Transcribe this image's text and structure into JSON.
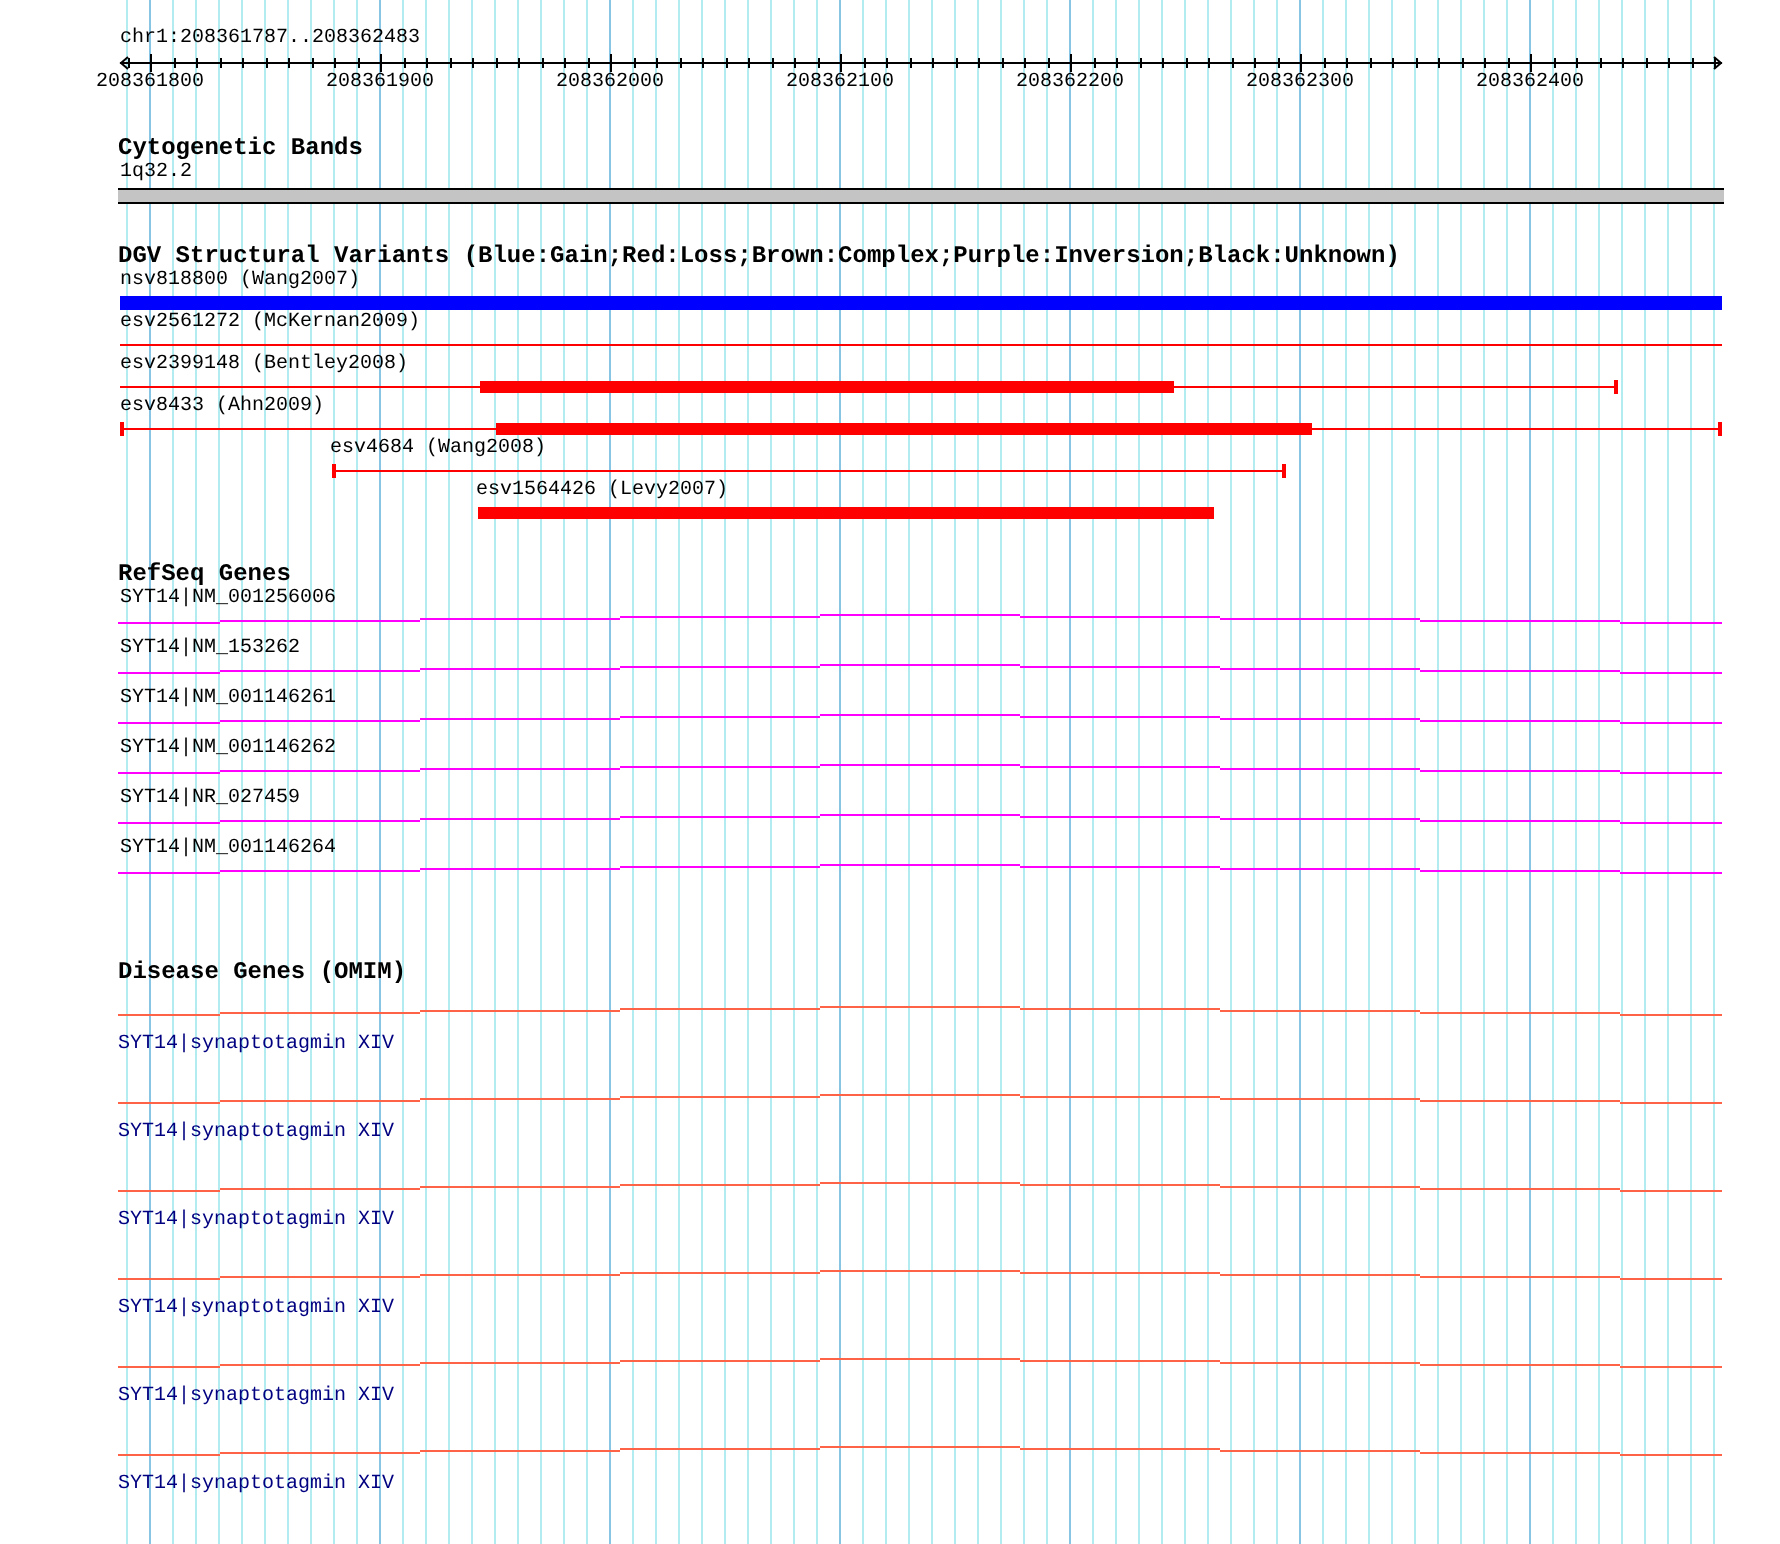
{
  "ruler": {
    "position": "chr1:208361787..208362483",
    "ticks": [
      "208361800",
      "208361900",
      "208362000",
      "208362100",
      "208362200",
      "208362300",
      "208362400"
    ]
  },
  "cytogenetic_bands": {
    "title": "Cytogenetic Bands",
    "band": "1q32.2"
  },
  "dgv": {
    "title": "DGV Structural Variants (Blue:Gain;Red:Loss;Brown:Complex;Purple:Inversion;Black:Unknown)",
    "variants": [
      {
        "label": "nsv818800 (Wang2007)",
        "color": "#0000ff"
      },
      {
        "label": "esv2561272 (McKernan2009)",
        "color": "#ff0000"
      },
      {
        "label": "esv2399148 (Bentley2008)",
        "color": "#ff0000"
      },
      {
        "label": "esv8433 (Ahn2009)",
        "color": "#ff0000"
      },
      {
        "label": "esv4684 (Wang2008)",
        "color": "#ff0000"
      },
      {
        "label": "esv1564426 (Levy2007)",
        "color": "#ff0000"
      }
    ]
  },
  "refseq_genes": {
    "title": "RefSeq Genes",
    "genes": [
      {
        "label": "SYT14|NM_001256006"
      },
      {
        "label": "SYT14|NM_153262"
      },
      {
        "label": "SYT14|NM_001146261"
      },
      {
        "label": "SYT14|NM_001146262"
      },
      {
        "label": "SYT14|NR_027459"
      },
      {
        "label": "SYT14|NM_001146264"
      }
    ]
  },
  "disease_genes": {
    "title": "Disease Genes (OMIM)",
    "genes": [
      {
        "label": "SYT14|synaptotagmin XIV"
      },
      {
        "label": "SYT14|synaptotagmin XIV"
      },
      {
        "label": "SYT14|synaptotagmin XIV"
      },
      {
        "label": "SYT14|synaptotagmin XIV"
      },
      {
        "label": "SYT14|synaptotagmin XIV"
      },
      {
        "label": "SYT14|synaptotagmin XIV"
      }
    ]
  }
}
